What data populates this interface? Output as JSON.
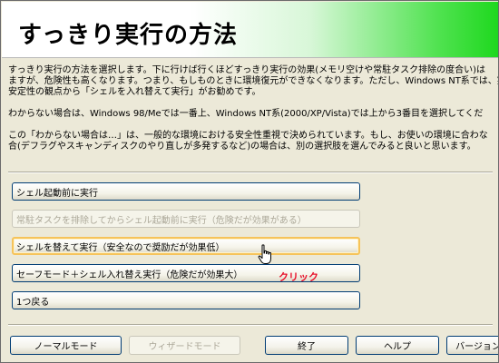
{
  "header": {
    "title": "すっきり実行の方法"
  },
  "description": {
    "lines": [
      "すっきり実行の方法を選択します。下に行けば行くほどすっきり実行の効果(メモリ空けや常駐タスク排除の度合い)は",
      "ますが、危険性も高くなります。つまり、もしものときに環境復元ができなくなります。ただし、Windows NT系では、実行",
      "安定性の観点から「シェルを入れ替えて実行」がお勧めです。",
      "わからない場合は、Windows 98/Meでは一番上、Windows NT系(2000/XP/Vista)では上から3番目を選択してくだ",
      "この「わからない場合は…」は、一般的な環境における安全性重視で決められています。もし、お使いの環境に合わな",
      "合(デフラグやスキャンディスクのやり直しが多発するなど)の場合は、別の選択肢を選んでみると良いと思います。"
    ]
  },
  "options": [
    {
      "label": "シェル起動前に実行"
    },
    {
      "label": "常駐タスクを排除してからシェル起動前に実行（危険だが効果がある）"
    },
    {
      "label": "シェルを替えて実行（安全なので奨励だが効果低）"
    },
    {
      "label": "セーフモード＋シェル入れ替え実行（危険だが効果大）"
    },
    {
      "label": "1つ戻る"
    }
  ],
  "footer": {
    "normal_mode": "ノーマルモード",
    "wizard_mode": "ウィザードモード",
    "exit": "終了",
    "help": "ヘルプ",
    "version": "バージョン"
  },
  "annotation": {
    "text": "クリック",
    "color": "#e8102a"
  },
  "colors": {
    "header_gradient_end": "#1ed81e",
    "button_border": "#003c74",
    "hover_border": "#f6c35a",
    "dialog_bg": "#ece9d8"
  },
  "icons": {
    "cursor": "hand-pointer-icon"
  }
}
